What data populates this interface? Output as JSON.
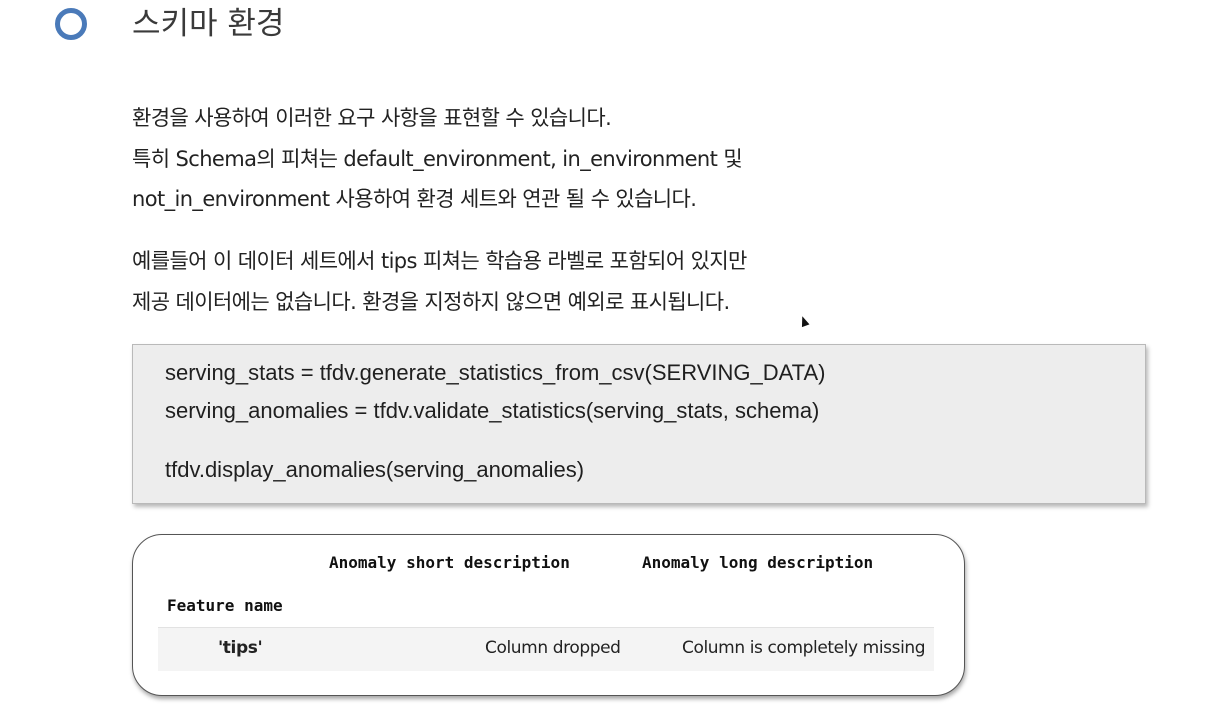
{
  "heading": "스키마 환경",
  "paragraph1": {
    "lines": [
      "환경을 사용하여 이러한 요구 사항을 표현할 수 있습니다.",
      "특히 Schema의 피쳐는 default_environment, in_environment 및",
      "not_in_environment 사용하여 환경 세트와 연관 될 수 있습니다."
    ]
  },
  "paragraph2": {
    "lines": [
      "예를들어 이 데이터 세트에서 tips 피쳐는 학습용 라벨로 포함되어 있지만",
      "제공 데이터에는 없습니다. 환경을 지정하지 않으면 예외로 표시됩니다."
    ]
  },
  "code": {
    "lines": [
      "serving_stats = tfdv.generate_statistics_from_csv(SERVING_DATA)",
      "serving_anomalies = tfdv.validate_statistics(serving_stats, schema)",
      "tfdv.display_anomalies(serving_anomalies)"
    ]
  },
  "table": {
    "headers": {
      "short_description": "Anomaly short description",
      "long_description": "Anomaly long description",
      "feature_name": "Feature name"
    },
    "rows": [
      {
        "feature": "'tips'",
        "short_description": "Column dropped",
        "long_description": "Column is completely missing"
      }
    ]
  },
  "colors": {
    "bullet": "#4a7ab9",
    "code_background": "#ededed"
  }
}
